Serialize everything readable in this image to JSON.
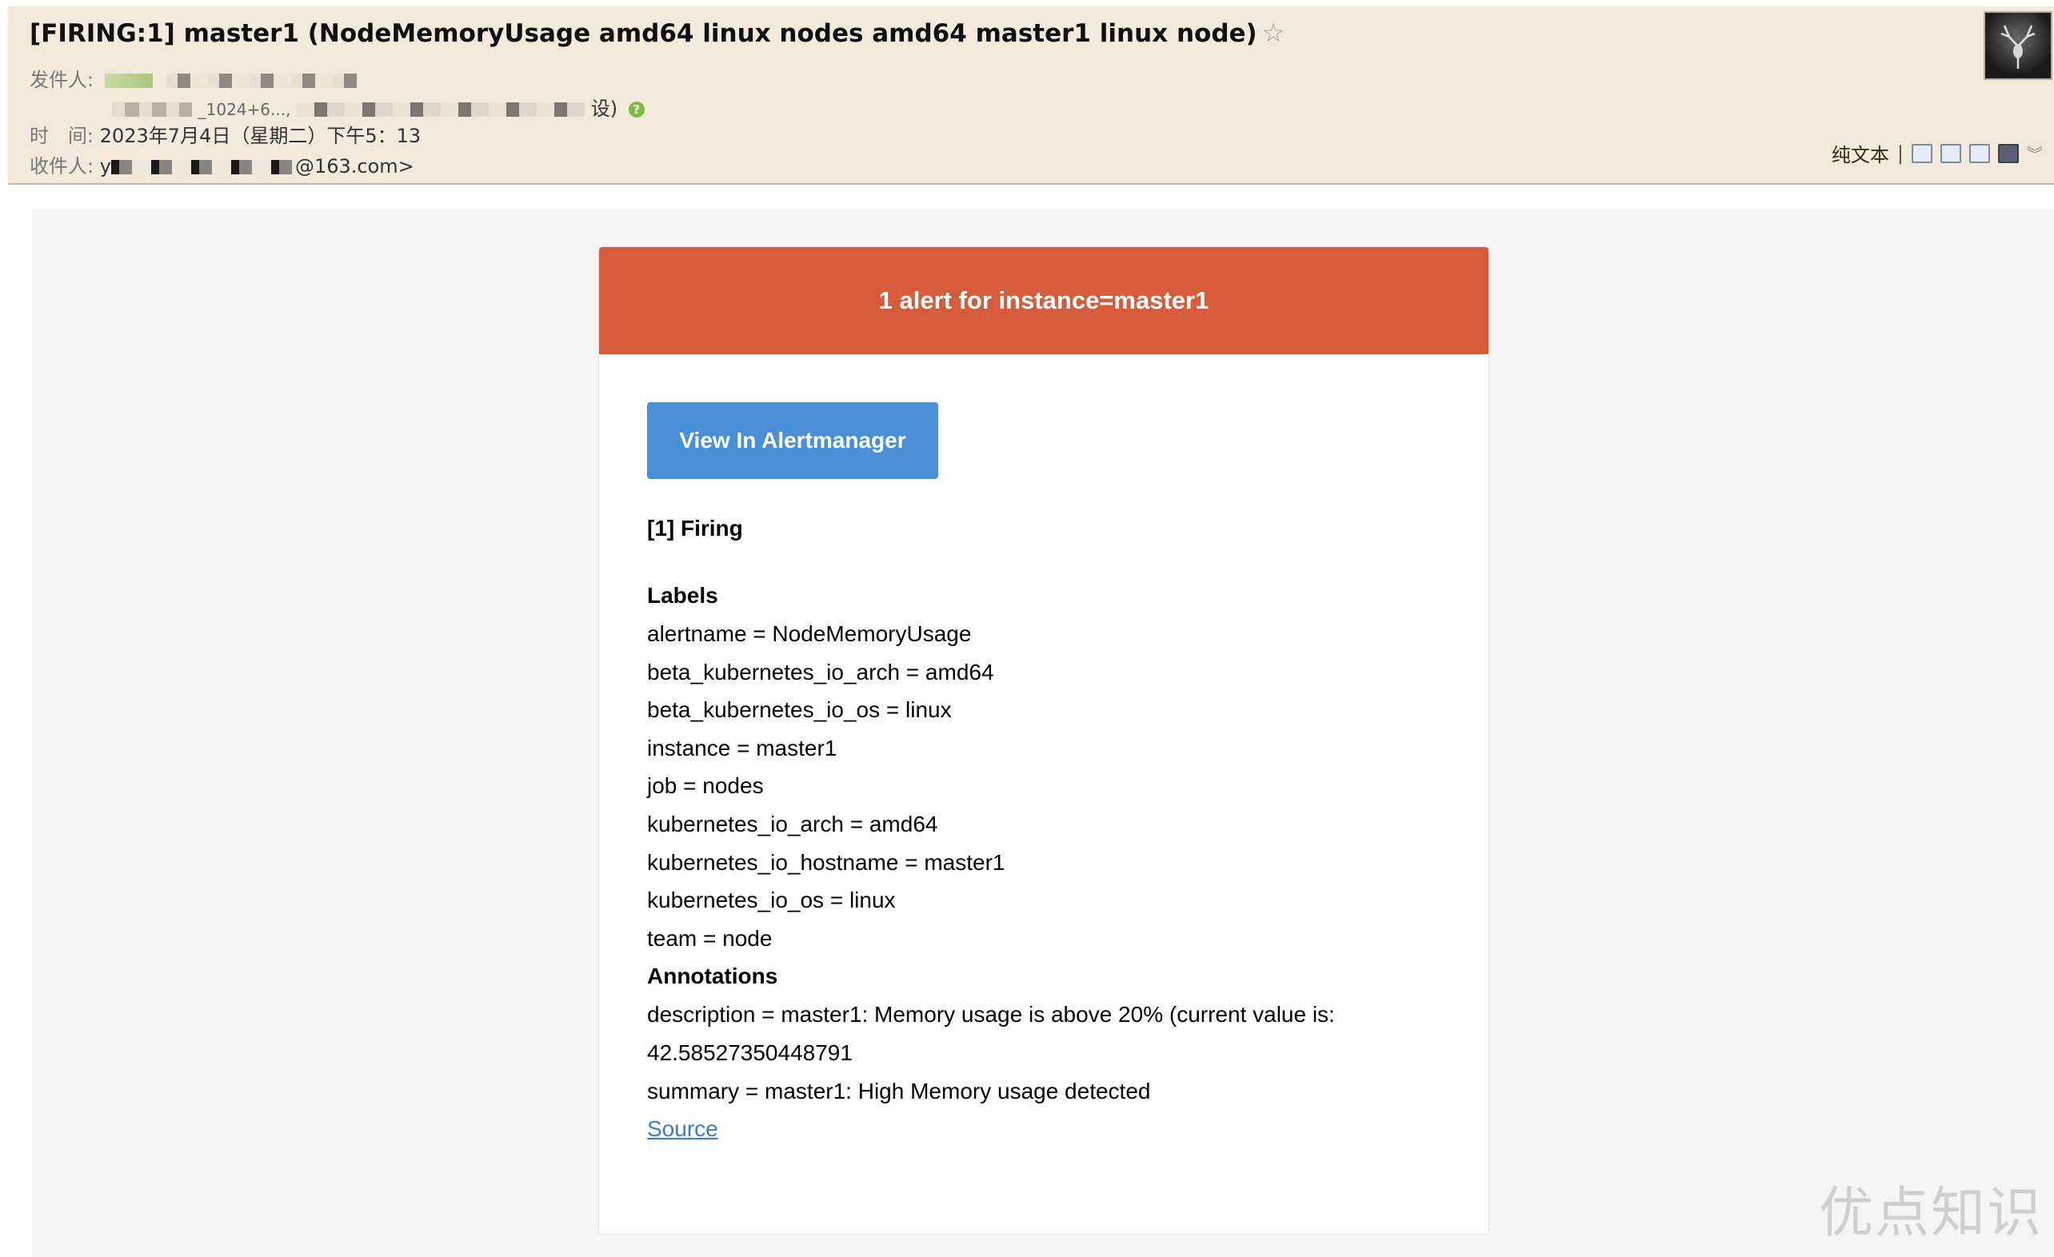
{
  "header": {
    "subject": "[FIRING:1] master1 (NodeMemoryUsage amd64 linux nodes amd64 master1 linux node)",
    "star": "☆",
    "from_label": "发件人:",
    "from_fragment": "_1024+6...,",
    "from_suffix": "设)",
    "verified_icon": "?",
    "time_label": "时　间:",
    "time_value": "2023年7月4日（星期二）下午5：13",
    "to_label": "收件人:",
    "to_prefix": "y",
    "to_suffix": "@163.com>"
  },
  "toolbar": {
    "plain_text": "纯文本",
    "separator": "|",
    "icons": [
      "new-window-icon",
      "view-source-icon",
      "download-icon",
      "print-icon"
    ],
    "more": "︾"
  },
  "alert": {
    "banner": "1 alert for instance=master1",
    "banner_color": "#d65c3b",
    "button_label": "View In Alertmanager",
    "button_color": "#4a90d9",
    "firing_heading": "[1] Firing",
    "labels_heading": "Labels",
    "labels": [
      "alertname = NodeMemoryUsage",
      "beta_kubernetes_io_arch = amd64",
      "beta_kubernetes_io_os = linux",
      "instance = master1",
      "job = nodes",
      "kubernetes_io_arch = amd64",
      "kubernetes_io_hostname = master1",
      "kubernetes_io_os = linux",
      "team = node"
    ],
    "annotations_heading": "Annotations",
    "annotations": [
      "description = master1: Memory usage is above 20% (current value is:",
      "42.58527350448791",
      "summary = master1: High Memory usage detected"
    ],
    "source_link": "Source"
  },
  "watermark": "优点知识"
}
